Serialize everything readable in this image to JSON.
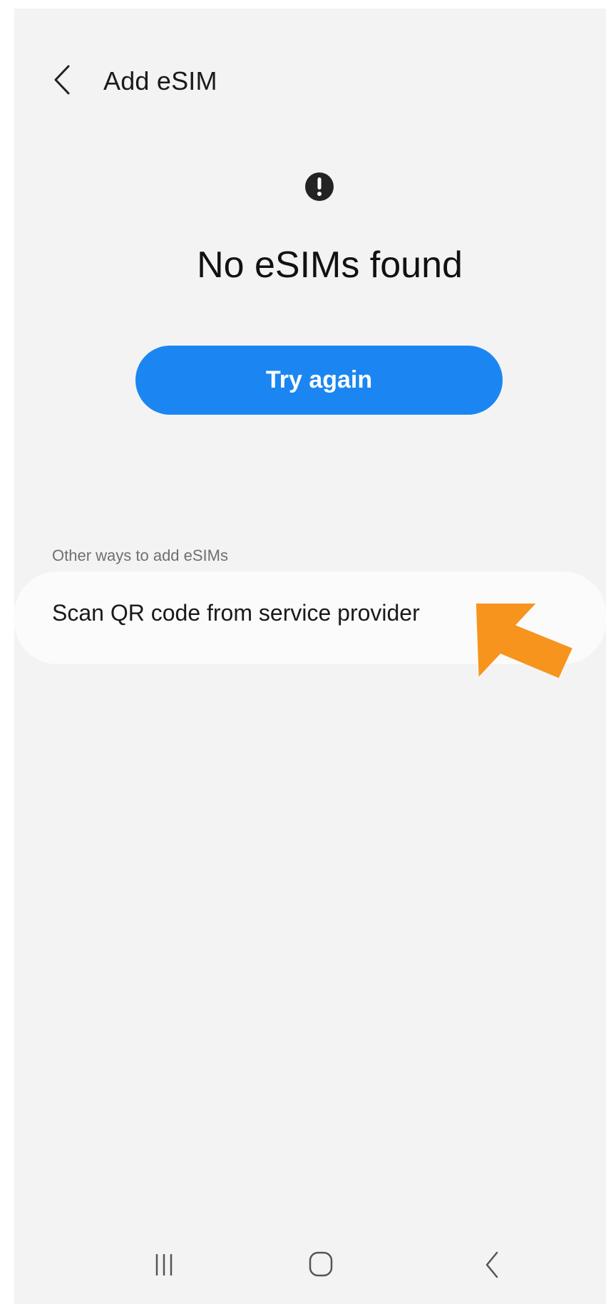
{
  "app_bar": {
    "title": "Add eSIM",
    "back_icon": "chevron-left-icon"
  },
  "status": {
    "icon": "alert-circle-icon",
    "message": "No eSIMs found"
  },
  "actions": {
    "try_again_label": "Try again"
  },
  "other_ways": {
    "section_label": "Other ways to add eSIMs",
    "options": [
      {
        "label": "Scan QR code from service provider"
      }
    ]
  },
  "annotation": {
    "icon": "arrow-pointer-icon",
    "color": "#f7941d"
  },
  "nav_bar": {
    "items": [
      {
        "icon": "recents-icon"
      },
      {
        "icon": "home-icon"
      },
      {
        "icon": "back-icon"
      }
    ]
  },
  "colors": {
    "background": "#f3f3f3",
    "primary": "#1b86f2",
    "card": "#fbfbfb",
    "text": "#1a1a1a",
    "secondary_text": "#6f6f6f"
  }
}
